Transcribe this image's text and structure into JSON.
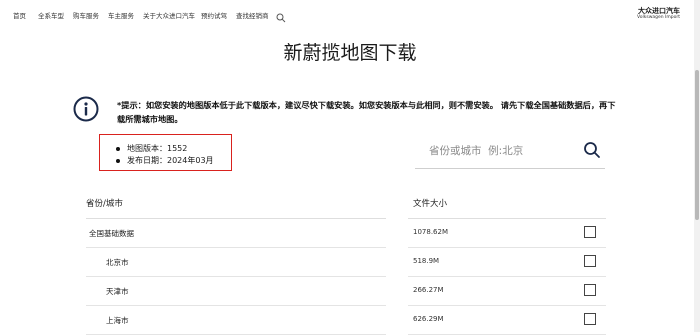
{
  "nav": {
    "items": [
      "首页",
      "全系车型",
      "购车服务",
      "车主服务",
      "关于大众进口汽车",
      "预约试驾",
      "查找经销商"
    ],
    "search_icon": "search-icon",
    "brand_cn": "大众进口汽车",
    "brand_en": "Volkswagen Import"
  },
  "page": {
    "title": "新蔚揽地图下载",
    "notice_icon": "info-icon",
    "notice": "*提示：如您安装的地图版本低于此下载版本，建议尽快下载安装。如您安装版本与此相同，则不需安装。 请先下载全国基础数据后，再下载所需城市地图。"
  },
  "version": {
    "version_line": "地图版本：1552",
    "date_line": "发布日期：2024年03月"
  },
  "search": {
    "placeholder": "省份或城市  例:北京",
    "value": ""
  },
  "table": {
    "col_region": "省份/城市",
    "col_size": "文件大小",
    "rows": [
      {
        "name": "全国基础数据",
        "size": "1078.62M",
        "indent": false,
        "checked": false
      },
      {
        "name": "北京市",
        "size": "518.9M",
        "indent": true,
        "checked": false
      },
      {
        "name": "天津市",
        "size": "266.27M",
        "indent": true,
        "checked": false
      },
      {
        "name": "上海市",
        "size": "626.29M",
        "indent": true,
        "checked": false
      }
    ]
  },
  "colors": {
    "highlight_border": "#d9221e",
    "icon_navy": "#1b2a4a"
  }
}
